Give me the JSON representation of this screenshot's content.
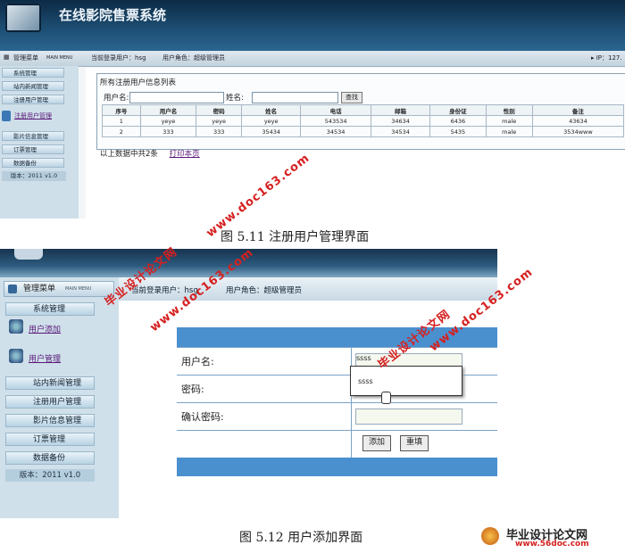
{
  "screen1": {
    "app_title": "在线影院售票系统",
    "menu_header": "管理菜单",
    "menu_header_sub": "MAIN MENU",
    "current_user": "当前登录用户：hsg",
    "user_role": "用户角色：超级管理员",
    "ip_label": "▸ IP：127.",
    "sidebar_items": [
      "系统管理",
      "站内新闻管理",
      "注册用户管理",
      "注册用户管理",
      "影片信息管理",
      "订票管理",
      "数据备份"
    ],
    "version": "版本：2011 v1.0",
    "panel_title": "所有注册用户信息列表",
    "search": {
      "username_label": "用户名:",
      "name_label": "姓名:",
      "button": "查找"
    },
    "table_headers": [
      "序号",
      "用户名",
      "密码",
      "姓名",
      "电话",
      "邮箱",
      "身份证",
      "性别",
      "备注"
    ],
    "table_rows": [
      [
        "1",
        "yeye",
        "yeye",
        "yeye",
        "543534",
        "34634",
        "6436",
        "male",
        "43634"
      ],
      [
        "2",
        "333",
        "333",
        "35434",
        "34534",
        "34534",
        "5435",
        "male",
        "3534www"
      ]
    ],
    "footer_text": "以上数据中共2条",
    "print_link": "打印本页"
  },
  "caption1": "图 5.11 注册用户管理界面",
  "screen2": {
    "menu_header": "管理菜单",
    "menu_header_sub": "MAIN MENU",
    "current_user": "当前登录用户：hsg",
    "user_role": "用户角色：超级管理员",
    "sidebar_top": [
      "系统管理"
    ],
    "sidebar_links": [
      "用户添加",
      "用户管理"
    ],
    "sidebar_items": [
      "站内新闻管理",
      "注册用户管理",
      "影片信息管理",
      "订票管理",
      "数据备份"
    ],
    "version": "版本：2011 v1.0",
    "form": {
      "username_label": "用户名:",
      "username_value": "ssss",
      "password_label": "密码:",
      "confirm_label": "确认密码:",
      "add_button": "添加",
      "reset_button": "重填"
    },
    "autocomplete_option": "ssss"
  },
  "caption2": "图 5.12 用户添加界面",
  "watermarks": [
    "毕业设计论文网",
    "www.doc163.com"
  ],
  "logo": {
    "title": "毕业设计论文网",
    "url": "www.56doc.com"
  }
}
